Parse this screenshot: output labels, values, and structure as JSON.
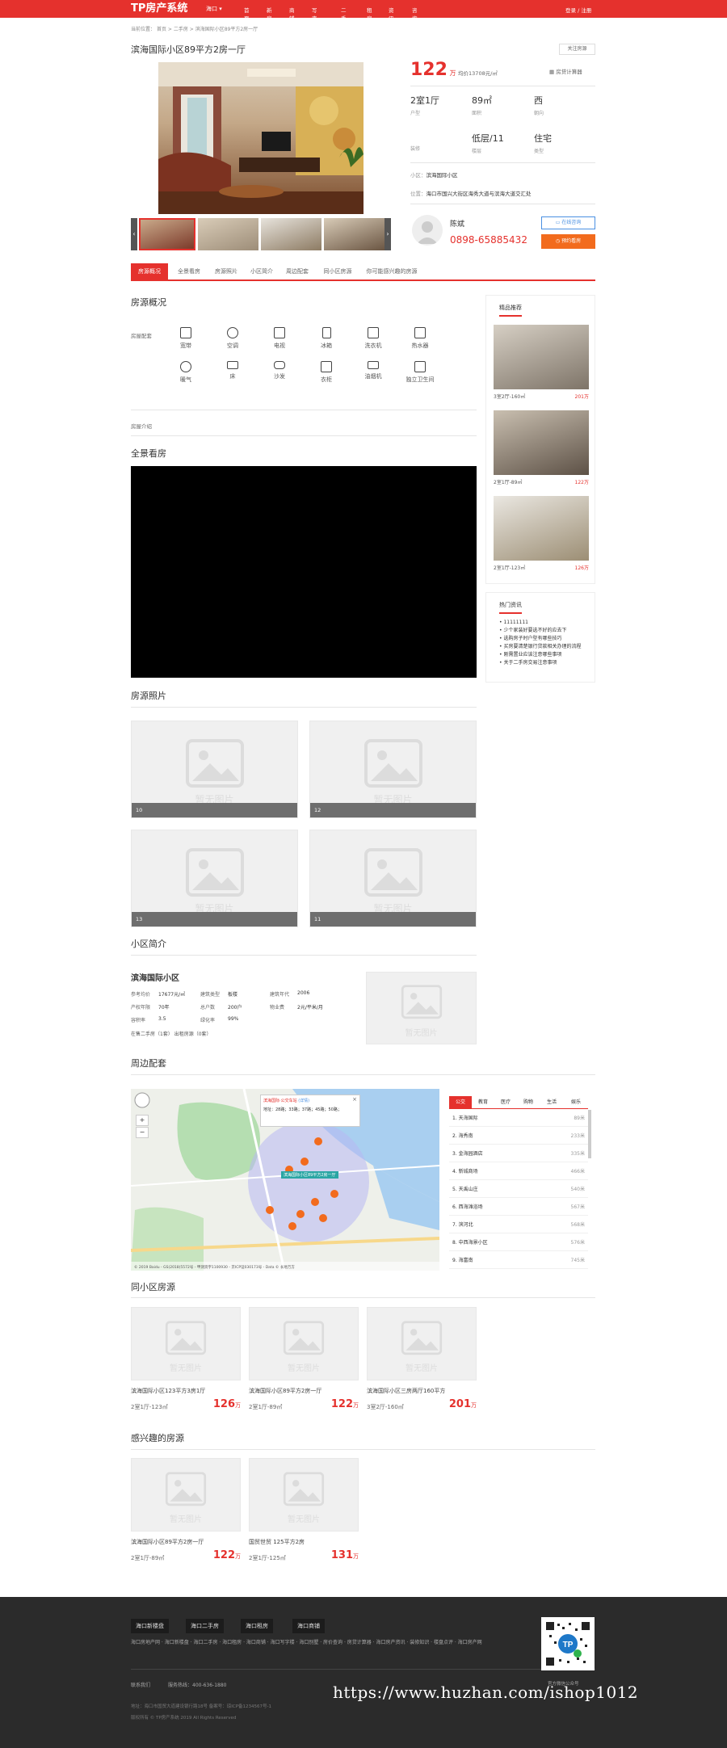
{
  "colors": {
    "brand": "#e5312d",
    "dark": "#2b2b2b"
  },
  "nav": {
    "logo": "TP房产系统",
    "city": "海口",
    "items": [
      "首页",
      "新房",
      "商铺",
      "写字楼",
      "二手房",
      "租房",
      "资讯",
      "咨询"
    ],
    "login": "登录 / 注册"
  },
  "breadcrumb": [
    "当前位置：",
    "首页",
    ">",
    "二手房",
    ">",
    "滨海国际小区89平方2房一厅"
  ],
  "title": "滨海国际小区89平方2房一厅",
  "follow_btn": "关注房源",
  "price": {
    "value": "122",
    "unit": "万",
    "unit_price": "均价13708元/㎡"
  },
  "mortgage": "房贷计算器",
  "attrs": [
    {
      "value": "2室1厅",
      "label": "户型"
    },
    {
      "value": "89㎡",
      "label": "面积"
    },
    {
      "value": "西",
      "label": "朝向"
    },
    {
      "value": "",
      "label": "装修"
    },
    {
      "value": "低层/11",
      "label": "楼层"
    },
    {
      "value": "住宅",
      "label": "类型"
    }
  ],
  "community_label": "小区：",
  "community_value": "滨海国际小区",
  "location_label": "位置：",
  "location_value": "海口市国兴大街区海秀大道与滨海大道交汇处",
  "agent": {
    "name": "陈斌",
    "phone": "0898-65885432",
    "online_btn": "在线咨询",
    "appoint_btn": "预约看房"
  },
  "tabs": [
    "房源概况",
    "全景看房",
    "房源照片",
    "小区简介",
    "周边配套",
    "同小区房源",
    "你可能感兴趣的房源"
  ],
  "overview_title": "房源概况",
  "facility_label": "房屋配套",
  "facilities": [
    "宽带",
    "空调",
    "电视",
    "冰箱",
    "洗衣机",
    "热水器",
    "暖气",
    "床",
    "沙发",
    "衣柜",
    "油烟机",
    "独立卫生间"
  ],
  "intro_label": "房屋介绍",
  "panorama_title": "全景看房",
  "photos_title": "房源照片",
  "photos": [
    {
      "cap": "10",
      "ph": "暂无图片"
    },
    {
      "cap": "12",
      "ph": "暂无图片"
    },
    {
      "cap": "13",
      "ph": "暂无图片"
    },
    {
      "cap": "11",
      "ph": "暂无图片"
    }
  ],
  "community_title": "小区简介",
  "community": {
    "name": "滨海国际小区",
    "info": [
      [
        "参考均价",
        "17677元/㎡",
        "建筑类型",
        "板楼",
        "建筑年代",
        "2006"
      ],
      [
        "产权年限",
        "70年",
        "总户数",
        "200户",
        "物业费",
        "2元/平米/月"
      ],
      [
        "容积率",
        "3.5",
        "绿化率",
        "99%",
        "",
        ""
      ]
    ],
    "note": "在售二手房（1套）  出租房源（0套）",
    "ph": "暂无图片"
  },
  "around_title": "周边配套",
  "map": {
    "popup_title": "滨海国际·公交车站",
    "popup_sub": "(详情)",
    "popup_lines": "地址：28路；33路；37路；45路；50路；",
    "label": "滨海国际小区89平方2房一厅",
    "copyright": "© 2019 Baidu - GS(2018)5572号 - 甲测资字1100930 - 京ICP证030173号 - Data © 长地万方",
    "tabs": [
      "公交",
      "教育",
      "医疗",
      "购物",
      "生活",
      "娱乐"
    ],
    "list": [
      [
        "1. 天海国际",
        "89米"
      ],
      [
        "2. 海秀南",
        "233米"
      ],
      [
        "3. 金海园酒店",
        "335米"
      ],
      [
        "4. 新城商场",
        "466米"
      ],
      [
        "5. 天禹山庄",
        "540米"
      ],
      [
        "6. 西海滩浴场",
        "567米"
      ],
      [
        "7. 滨河北",
        "568米"
      ],
      [
        "8. 中西海景小区",
        "576米"
      ],
      [
        "9. 海富南",
        "745米"
      ]
    ]
  },
  "same_title": "同小区房源",
  "same": [
    {
      "title": "滨海国际小区123平方3房1厅",
      "sub": "2室1厅-123㎡",
      "price": "126",
      "unit": "万",
      "ph": "暂无图片"
    },
    {
      "title": "滨海国际小区89平方2房一厅",
      "sub": "2室1厅-89㎡",
      "price": "122",
      "unit": "万",
      "ph": "暂无图片"
    },
    {
      "title": "滨海国际小区三房两厅160平方",
      "sub": "3室2厅-160㎡",
      "price": "201",
      "unit": "万",
      "ph": "暂无图片"
    }
  ],
  "interest_title": "感兴趣的房源",
  "interest": [
    {
      "title": "滨海国际小区89平方2房一厅",
      "sub": "2室1厅-89㎡",
      "price": "122",
      "unit": "万",
      "ph": "暂无图片"
    },
    {
      "title": "国贸世贸 125平方2房",
      "sub": "2室1厅-125㎡",
      "price": "131",
      "unit": "万",
      "ph": "暂无图片"
    }
  ],
  "recommend": {
    "title": "精品推荐",
    "items": [
      {
        "sub": "3室2厅-160㎡",
        "price": "201万"
      },
      {
        "sub": "2室1厅-89㎡",
        "price": "122万"
      },
      {
        "sub": "2室1厅-123㎡",
        "price": "126万"
      }
    ]
  },
  "news": {
    "title": "热门资讯",
    "items": [
      "11111111",
      "少个家装好要选不好的应去下",
      "选购房子时户型有哪些技巧",
      "买房要清楚银行贷款相关办理的流程",
      "刚需置业应该注意哪些事项",
      "关于二手房交易注意事项"
    ]
  },
  "footer": {
    "btns": [
      "海口新楼盘",
      "海口二手房",
      "海口租房",
      "海口商铺"
    ],
    "links": "海口房地产网 · 海口新楼盘 · 海口二手房 · 海口租房 · 海口商铺 · 海口写字楼 · 海口别墅 · 房价查询 · 房贷计算器 · 海口房产资讯 · 装修知识 · 楼盘点评 · 海口房产网",
    "contact1": "联系我们",
    "contact2": "服务热线：400-636-1880",
    "copy1": "地址：海口市国贸大道建设银行路18号   备案号：琼ICP备1234567号-1",
    "copy2": "版权所有 © TP房产系统  2019 All Rights Reserved",
    "qr_label": "官方微信公众号"
  },
  "watermark": "https://www.huzhan.com/ishop1012"
}
